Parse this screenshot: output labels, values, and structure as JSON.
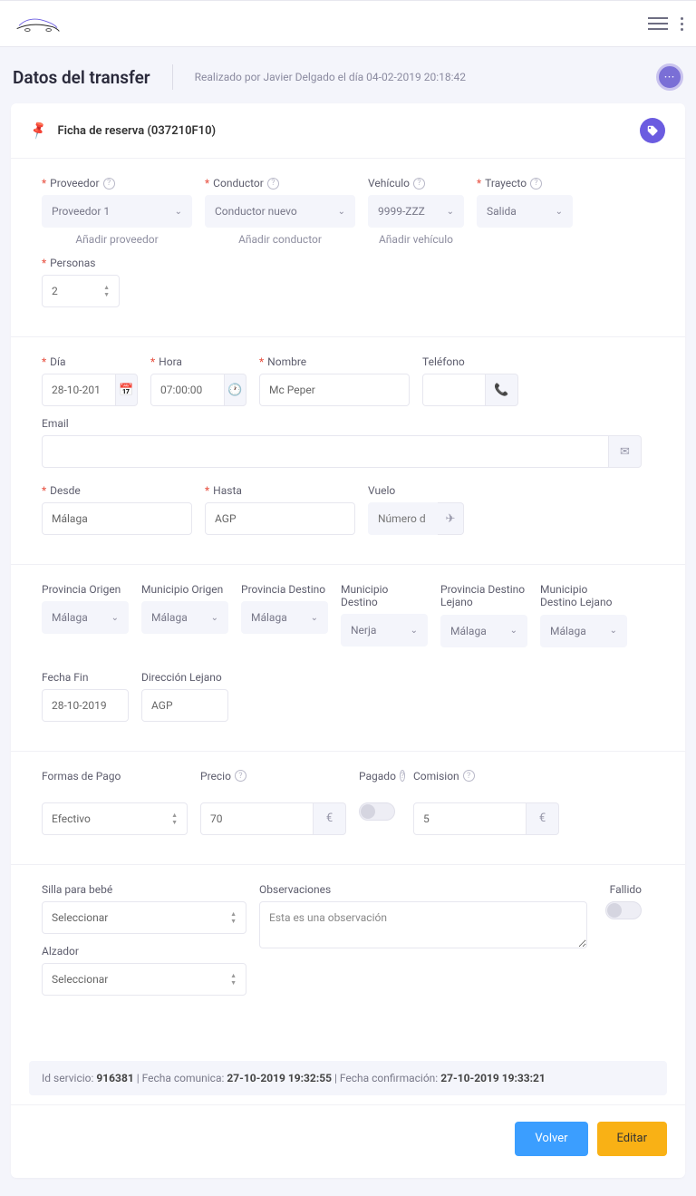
{
  "header": {
    "title": "Datos del transfer",
    "subtitle": "Realizado por Javier Delgado el día 04-02-2019 20:18:42",
    "action_label": "···"
  },
  "card": {
    "title": "Ficha de reserva  (037210F10)"
  },
  "sec1": {
    "proveedor_label": "Proveedor",
    "proveedor_value": "Proveedor 1",
    "proveedor_add": "Añadir proveedor",
    "conductor_label": "Conductor",
    "conductor_value": "Conductor nuevo",
    "conductor_add": "Añadir conductor",
    "vehiculo_label": "Vehículo",
    "vehiculo_value": "9999-ZZZ",
    "vehiculo_add": "Añadir vehículo",
    "trayecto_label": "Trayecto",
    "trayecto_value": "Salida",
    "personas_label": "Personas",
    "personas_value": "2"
  },
  "sec2": {
    "dia_label": "Día",
    "dia_value": "28-10-201",
    "hora_label": "Hora",
    "hora_value": "07:00:00",
    "nombre_label": "Nombre",
    "nombre_value": "Mc Peper",
    "telefono_label": "Teléfono",
    "email_label": "Email",
    "desde_label": "Desde",
    "desde_value": "Málaga",
    "hasta_label": "Hasta",
    "hasta_value": "AGP",
    "vuelo_label": "Vuelo",
    "vuelo_ph": "Número d"
  },
  "sec3": {
    "prov_origen_label": "Provincia Origen",
    "prov_origen_value": "Málaga",
    "mun_origen_label": "Municipio Origen",
    "mun_origen_value": "Málaga",
    "prov_dest_label": "Provincia Destino",
    "prov_dest_value": "Málaga",
    "mun_dest_label": "Municipio Destino",
    "mun_dest_value": "Nerja",
    "prov_dest_lej_label": "Provincia Destino Lejano",
    "prov_dest_lej_value": "Málaga",
    "mun_dest_lej_label": "Municipio Destino Lejano",
    "mun_dest_lej_value": "Málaga",
    "fecha_fin_label": "Fecha Fin",
    "fecha_fin_value": "28-10-2019",
    "dir_lej_label": "Dirección Lejano",
    "dir_lej_value": "AGP"
  },
  "sec4": {
    "pago_label": "Formas de Pago",
    "pago_value": "Efectivo",
    "precio_label": "Precio",
    "precio_value": "70",
    "currency": "€",
    "pagado_label": "Pagado",
    "comision_label": "Comision",
    "comision_value": "5"
  },
  "sec5": {
    "silla_label": "Silla para bebé",
    "silla_value": "Seleccionar",
    "alzador_label": "Alzador",
    "alzador_value": "Seleccionar",
    "obs_label": "Observaciones",
    "obs_value": "Esta es una observación",
    "fallido_label": "Fallido"
  },
  "footer": {
    "id_label": "Id servicio: ",
    "id_value": "916381",
    "comunica_label": " | Fecha comunica: ",
    "comunica_value": "27-10-2019 19:32:55",
    "confirm_label": " | Fecha confirmación: ",
    "confirm_value": "27-10-2019 19:33:21"
  },
  "actions": {
    "volver": "Volver",
    "editar": "Editar"
  }
}
